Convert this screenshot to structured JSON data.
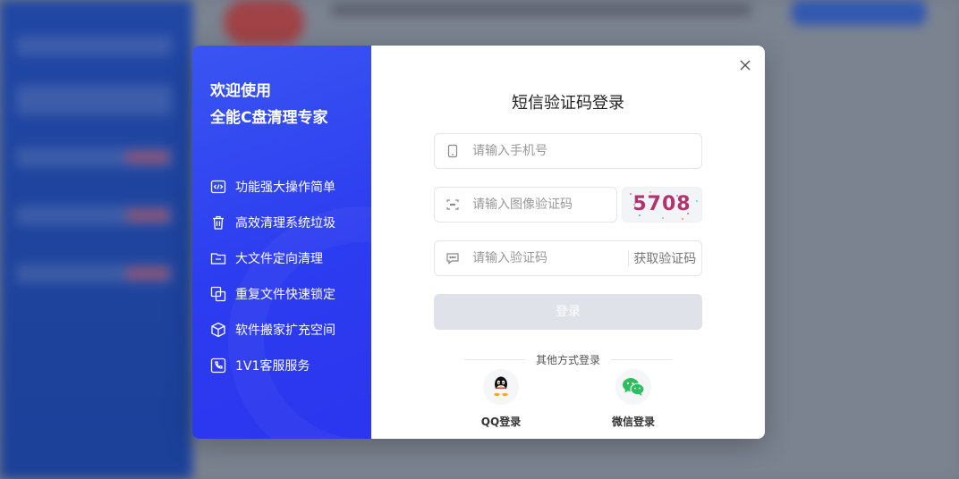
{
  "modal": {
    "welcome_line1": "欢迎使用",
    "welcome_line2": "全能C盘清理专家",
    "features": [
      {
        "label": "功能强大操作简单",
        "icon": "code-window-icon"
      },
      {
        "label": "高效清理系统垃圾",
        "icon": "trash-icon"
      },
      {
        "label": "大文件定向清理",
        "icon": "folder-icon"
      },
      {
        "label": "重复文件快速锁定",
        "icon": "copy-icon"
      },
      {
        "label": "软件搬家扩充空间",
        "icon": "box-icon"
      },
      {
        "label": "1V1客服服务",
        "icon": "customer-service-icon"
      }
    ],
    "title": "短信验证码登录",
    "phone_placeholder": "请输入手机号",
    "captcha_placeholder": "请输入图像验证码",
    "captcha_code": "5708",
    "sms_placeholder": "请输入验证码",
    "get_code_label": "获取验证码",
    "login_label": "登录",
    "other_login_label": "其他方式登录",
    "qq_label": "QQ登录",
    "wechat_label": "微信登录"
  },
  "colors": {
    "left_panel": "#2c3cf0",
    "login_button_disabled": "#dfe2e8",
    "captcha_text": "#b0356e",
    "wechat_green": "#2dbe60"
  }
}
